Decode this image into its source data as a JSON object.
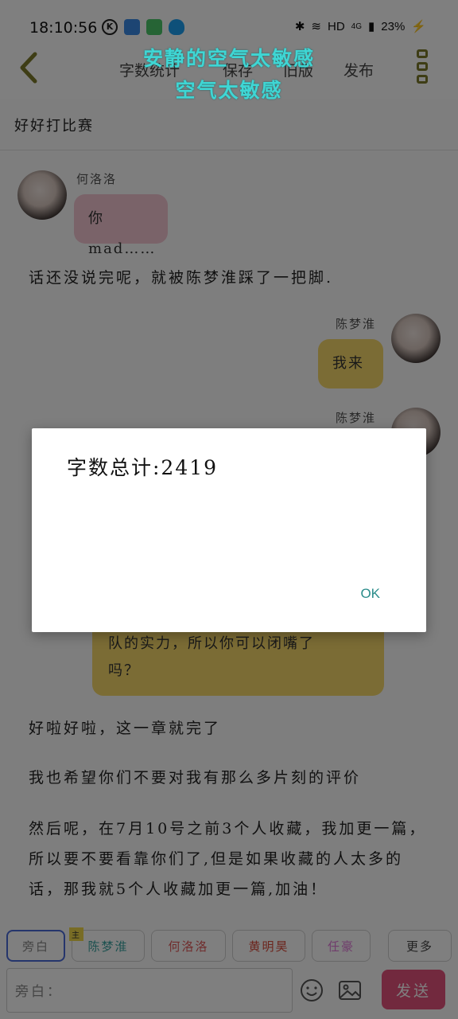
{
  "status_bar": {
    "time": "18:10:56",
    "network": "HD",
    "signal": "4G",
    "battery": "23%"
  },
  "header": {
    "menu": [
      "字数统计",
      "保存",
      "旧版",
      "发布"
    ],
    "overlay_title_line1": "安静的空气太敏感",
    "overlay_title_line2": "空气太敏感"
  },
  "chapter_title": "好好打比赛",
  "messages": [
    {
      "speaker": "何洛洛",
      "text": "你mad……",
      "side": "left",
      "color": "#f4c6d2"
    },
    {
      "narration": "话还没说完呢，就被陈梦淮踩了一把脚."
    },
    {
      "speaker": "陈梦淮",
      "text": "我来",
      "side": "right",
      "color": "#f7d86a"
    },
    {
      "speaker": "陈梦淮",
      "side": "right"
    },
    {
      "text_lines": [
        "队的实力，所以你可以闭嘴了",
        "吗？"
      ],
      "color": "#f7d86a"
    },
    {
      "narration": "好啦好啦，这一章就完了"
    },
    {
      "narration": "我也希望你们不要对我有那么多片刻的评价"
    },
    {
      "narration": "然后呢，在7月10号之前3个人收藏，我加更一篇，所以要不要看靠你们了,但是如果收藏的人太多的话，那我就5个人收藏加更一篇,加油！"
    }
  ],
  "characters": [
    {
      "label": "旁白",
      "color": "#888888",
      "selected": true
    },
    {
      "label": "陈梦淮",
      "color": "#3aa3a0",
      "badge": "主"
    },
    {
      "label": "何洛洛",
      "color": "#e05a5a"
    },
    {
      "label": "黄明昊",
      "color": "#d94a3a"
    },
    {
      "label": "任豪",
      "color": "#e07ad8"
    },
    {
      "label": "更多",
      "color": "#444444"
    }
  ],
  "input": {
    "placeholder": "旁白："
  },
  "send_label": "发送",
  "dialog": {
    "message": "字数总计:2419",
    "ok_label": "OK"
  }
}
